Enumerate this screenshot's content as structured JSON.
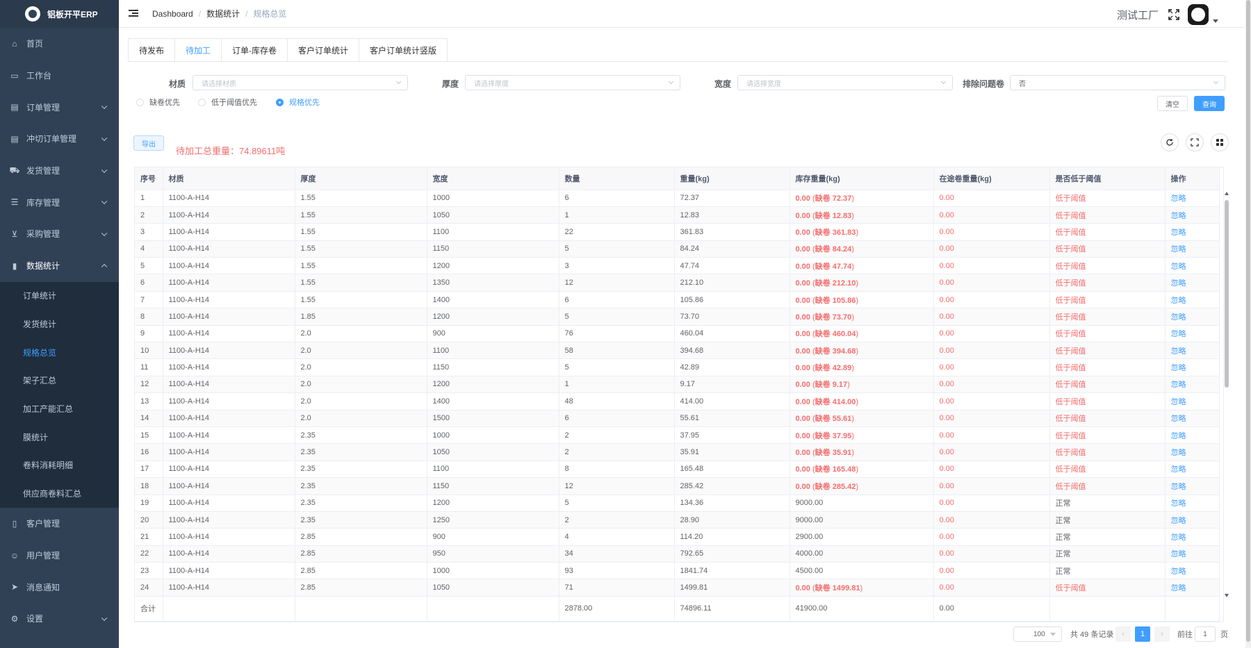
{
  "sidebar": {
    "brand": "铝板开平ERP",
    "items": [
      {
        "label": "首页",
        "icon": "home-icon",
        "has_arrow": false
      },
      {
        "label": "工作台",
        "icon": "monitor-icon",
        "has_arrow": false
      },
      {
        "label": "订单管理",
        "icon": "document-icon",
        "has_arrow": true
      },
      {
        "label": "冲切订单管理",
        "icon": "document-icon",
        "has_arrow": true
      },
      {
        "label": "发货管理",
        "icon": "truck-icon",
        "has_arrow": true
      },
      {
        "label": "库存管理",
        "icon": "database-icon",
        "has_arrow": true
      },
      {
        "label": "采购管理",
        "icon": "cart-icon",
        "has_arrow": true
      },
      {
        "label": "数据统计",
        "icon": "bar-chart-icon",
        "has_arrow": true
      }
    ],
    "sub_items": [
      "订单统计",
      "发货统计",
      "规格总览",
      "架子汇总",
      "加工产能汇总",
      "膜统计",
      "卷料消耗明细",
      "供应商卷料汇总"
    ],
    "bottom_items": [
      {
        "label": "客户管理",
        "icon": "book-icon",
        "has_arrow": false
      },
      {
        "label": "用户管理",
        "icon": "user-icon",
        "has_arrow": false
      },
      {
        "label": "消息通知",
        "icon": "send-icon",
        "has_arrow": false
      },
      {
        "label": "设置",
        "icon": "gear-icon",
        "has_arrow": true
      }
    ]
  },
  "header": {
    "breadcrumb": [
      "Dashboard",
      "数据统计",
      "规格总览"
    ],
    "factory": "测试工厂"
  },
  "tabs": [
    "待发布",
    "待加工",
    "订单-库存卷",
    "客户订单统计",
    "客户订单统计竖版"
  ],
  "filters": {
    "material": {
      "label": "材质",
      "placeholder": "请选择材质"
    },
    "thickness": {
      "label": "厚度",
      "placeholder": "请选择厚度"
    },
    "width": {
      "label": "宽度",
      "placeholder": "请选择宽度"
    },
    "exclude": {
      "label": "排除问题卷",
      "value": "否"
    },
    "radios": [
      "缺卷优先",
      "低于阈值优先",
      "规格优先"
    ],
    "clear": "清空",
    "query": "查询"
  },
  "toolbar": {
    "export": "导出",
    "total": "待加工总重量：74.89611吨"
  },
  "table": {
    "columns": [
      "序号",
      "材质",
      "厚度",
      "宽度",
      "数量",
      "重量(kg)",
      "库存重量(kg)",
      "在途卷重量(kg)",
      "是否低于阈值",
      "操作"
    ],
    "rows": [
      [
        "1",
        "1100-A-H14",
        "1.55",
        "1000",
        "6",
        "72.37",
        "0.00",
        "缺卷 72.37",
        "0.00",
        "低于阈值",
        "忽略"
      ],
      [
        "2",
        "1100-A-H14",
        "1.55",
        "1050",
        "1",
        "12.83",
        "0.00",
        "缺卷 12.83",
        "0.00",
        "低于阈值",
        "忽略"
      ],
      [
        "3",
        "1100-A-H14",
        "1.55",
        "1100",
        "22",
        "361.83",
        "0.00",
        "缺卷 361.83",
        "0.00",
        "低于阈值",
        "忽略"
      ],
      [
        "4",
        "1100-A-H14",
        "1.55",
        "1150",
        "5",
        "84.24",
        "0.00",
        "缺卷 84.24",
        "0.00",
        "低于阈值",
        "忽略"
      ],
      [
        "5",
        "1100-A-H14",
        "1.55",
        "1200",
        "3",
        "47.74",
        "0.00",
        "缺卷 47.74",
        "0.00",
        "低于阈值",
        "忽略"
      ],
      [
        "6",
        "1100-A-H14",
        "1.55",
        "1350",
        "12",
        "212.10",
        "0.00",
        "缺卷 212.10",
        "0.00",
        "低于阈值",
        "忽略"
      ],
      [
        "7",
        "1100-A-H14",
        "1.55",
        "1400",
        "6",
        "105.86",
        "0.00",
        "缺卷 105.86",
        "0.00",
        "低于阈值",
        "忽略"
      ],
      [
        "8",
        "1100-A-H14",
        "1.85",
        "1200",
        "5",
        "73.70",
        "0.00",
        "缺卷 73.70",
        "0.00",
        "低于阈值",
        "忽略"
      ],
      [
        "9",
        "1100-A-H14",
        "2.0",
        "900",
        "76",
        "460.04",
        "0.00",
        "缺卷 460.04",
        "0.00",
        "低于阈值",
        "忽略"
      ],
      [
        "10",
        "1100-A-H14",
        "2.0",
        "1100",
        "58",
        "394.68",
        "0.00",
        "缺卷 394.68",
        "0.00",
        "低于阈值",
        "忽略"
      ],
      [
        "11",
        "1100-A-H14",
        "2.0",
        "1150",
        "5",
        "42.89",
        "0.00",
        "缺卷 42.89",
        "0.00",
        "低于阈值",
        "忽略"
      ],
      [
        "12",
        "1100-A-H14",
        "2.0",
        "1200",
        "1",
        "9.17",
        "0.00",
        "缺卷 9.17",
        "0.00",
        "低于阈值",
        "忽略"
      ],
      [
        "13",
        "1100-A-H14",
        "2.0",
        "1400",
        "48",
        "414.00",
        "0.00",
        "缺卷 414.00",
        "0.00",
        "低于阈值",
        "忽略"
      ],
      [
        "14",
        "1100-A-H14",
        "2.0",
        "1500",
        "6",
        "55.61",
        "0.00",
        "缺卷 55.61",
        "0.00",
        "低于阈值",
        "忽略"
      ],
      [
        "15",
        "1100-A-H14",
        "2.35",
        "1000",
        "2",
        "37.95",
        "0.00",
        "缺卷 37.95",
        "0.00",
        "低于阈值",
        "忽略"
      ],
      [
        "16",
        "1100-A-H14",
        "2.35",
        "1050",
        "2",
        "35.91",
        "0.00",
        "缺卷 35.91",
        "0.00",
        "低于阈值",
        "忽略"
      ],
      [
        "17",
        "1100-A-H14",
        "2.35",
        "1100",
        "8",
        "165.48",
        "0.00",
        "缺卷 165.48",
        "0.00",
        "低于阈值",
        "忽略"
      ],
      [
        "18",
        "1100-A-H14",
        "2.35",
        "1150",
        "12",
        "285.42",
        "0.00",
        "缺卷 285.42",
        "0.00",
        "低于阈值",
        "忽略"
      ],
      [
        "19",
        "1100-A-H14",
        "2.35",
        "1200",
        "5",
        "134.36",
        "9000.00",
        "",
        "0.00",
        "正常",
        "忽略"
      ],
      [
        "20",
        "1100-A-H14",
        "2.35",
        "1250",
        "2",
        "28.90",
        "9000.00",
        "",
        "0.00",
        "正常",
        "忽略"
      ],
      [
        "21",
        "1100-A-H14",
        "2.85",
        "900",
        "4",
        "114.20",
        "2900.00",
        "",
        "0.00",
        "正常",
        "忽略"
      ],
      [
        "22",
        "1100-A-H14",
        "2.85",
        "950",
        "34",
        "792.65",
        "4000.00",
        "",
        "0.00",
        "正常",
        "忽略"
      ],
      [
        "23",
        "1100-A-H14",
        "2.85",
        "1000",
        "93",
        "1841.74",
        "4500.00",
        "",
        "0.00",
        "正常",
        "忽略"
      ],
      [
        "24",
        "1100-A-H14",
        "2.85",
        "1050",
        "71",
        "1499.81",
        "0.00",
        "缺卷 1499.81",
        "0.00",
        "低于阈值",
        "忽略"
      ]
    ],
    "summary": {
      "label": "合计",
      "quantity": "2878.00",
      "weight": "74896.11",
      "stock": "41900.00",
      "transit": "0.00"
    }
  },
  "pagination": {
    "page_size": "100",
    "total": "共 49 条记录",
    "current": "1",
    "goto_label": "前往",
    "goto_value": "1",
    "page_unit": "页"
  },
  "colors": {
    "primary": "#409eff",
    "danger": "#f56c6c",
    "sidebar": "#304156"
  }
}
